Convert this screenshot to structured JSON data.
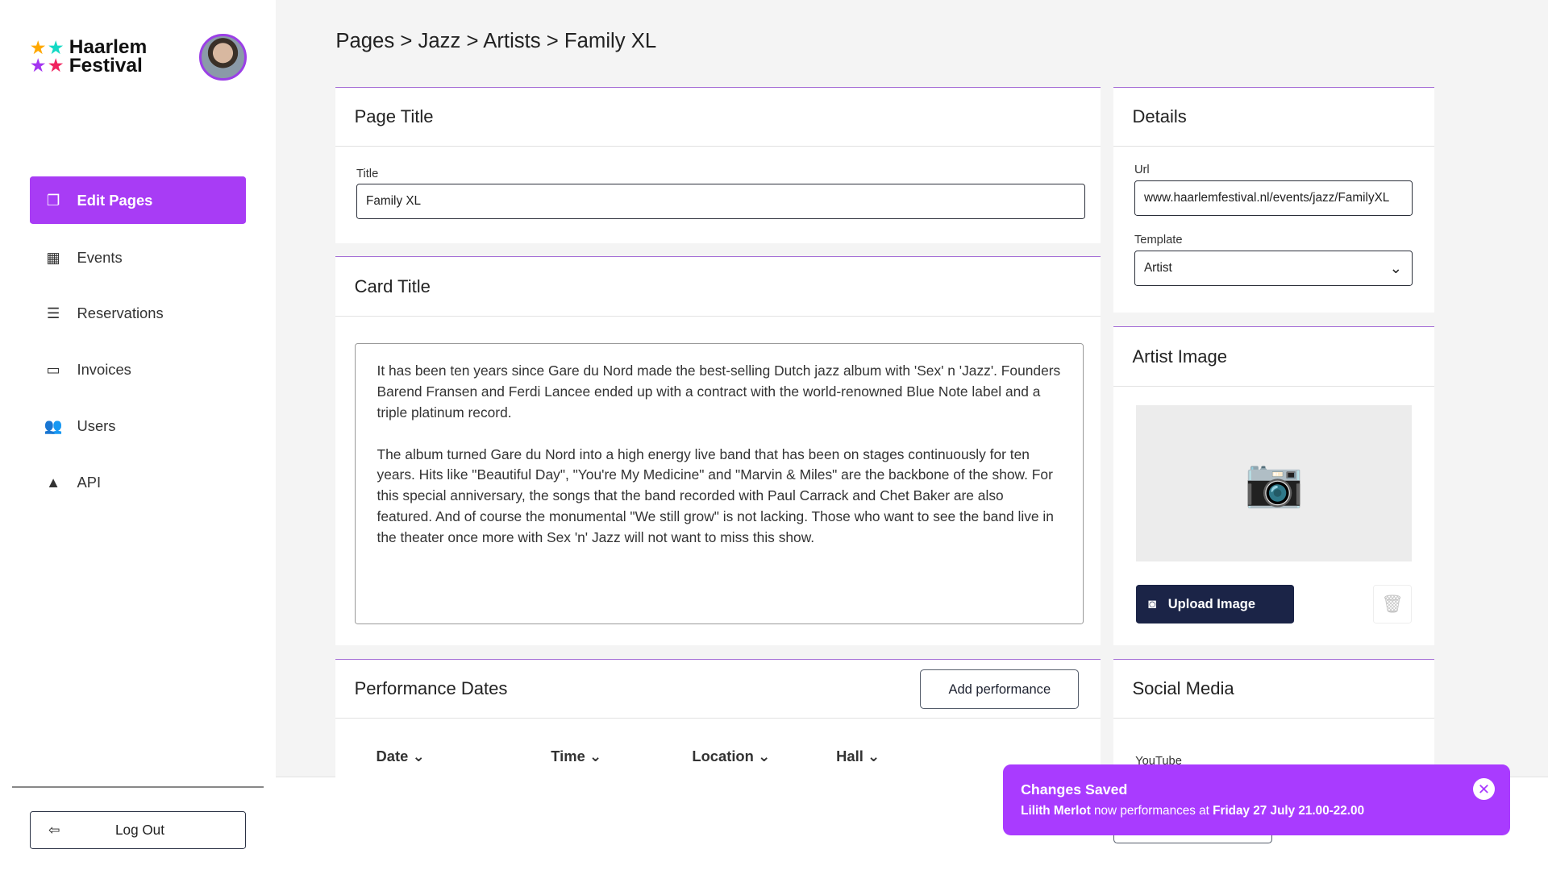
{
  "brand": {
    "line1": "Haarlem",
    "line2": "Festival",
    "star_colors": [
      "#ffa800",
      "#14d9c4",
      "#a435f0",
      "#f0245f"
    ]
  },
  "sidebar": {
    "items": [
      {
        "label": "Edit Pages",
        "icon": "pages-icon",
        "active": true
      },
      {
        "label": "Events",
        "icon": "calendar-icon"
      },
      {
        "label": "Reservations",
        "icon": "list-icon"
      },
      {
        "label": "Invoices",
        "icon": "credit-card-icon"
      },
      {
        "label": "Users",
        "icon": "users-icon"
      },
      {
        "label": "API",
        "icon": "shapes-icon"
      }
    ],
    "logout": "Log Out"
  },
  "breadcrumb": "Pages > Jazz > Artists > Family XL",
  "page_title_card": {
    "heading": "Page Title",
    "title_label": "Title",
    "title_value": "Family XL"
  },
  "card_title_card": {
    "heading": "Card Title",
    "text": "It has been ten years since Gare du Nord made the best-selling Dutch jazz album with 'Sex' n 'Jazz'. Founders Barend Fransen and Ferdi Lancee ended up with a contract with the world-renowned Blue Note label and a triple platinum record.\n\nThe album turned Gare du Nord into a high energy live band that has been on stages continuously for ten years. Hits like \"Beautiful Day\", \"You're My Medicine\" and \"Marvin & Miles\" are the backbone of the show. For this special anniversary, the songs that the band recorded with Paul Carrack and Chet Baker are also featured. And of course the monumental \"We still grow\" is not lacking. Those who want to see the band live in the theater once more with Sex 'n' Jazz will not want to miss this show."
  },
  "performance": {
    "heading": "Performance Dates",
    "add_label": "Add performance",
    "columns": [
      "Date",
      "Time",
      "Location",
      "Hall"
    ]
  },
  "details": {
    "heading": "Details",
    "url_label": "Url",
    "url_value": "www.haarlemfestival.nl/events/jazz/FamilyXL",
    "template_label": "Template",
    "template_value": "Artist"
  },
  "artist_image": {
    "heading": "Artist Image",
    "upload_label": "Upload Image"
  },
  "social": {
    "heading": "Social Media",
    "youtube_label": "YouTube"
  },
  "toast": {
    "title": "Changes Saved",
    "name": "Lilith Merlot",
    "middle": " now performances at ",
    "when": "Friday 27 July 21.00-22.00",
    "color": "#a93bff"
  }
}
